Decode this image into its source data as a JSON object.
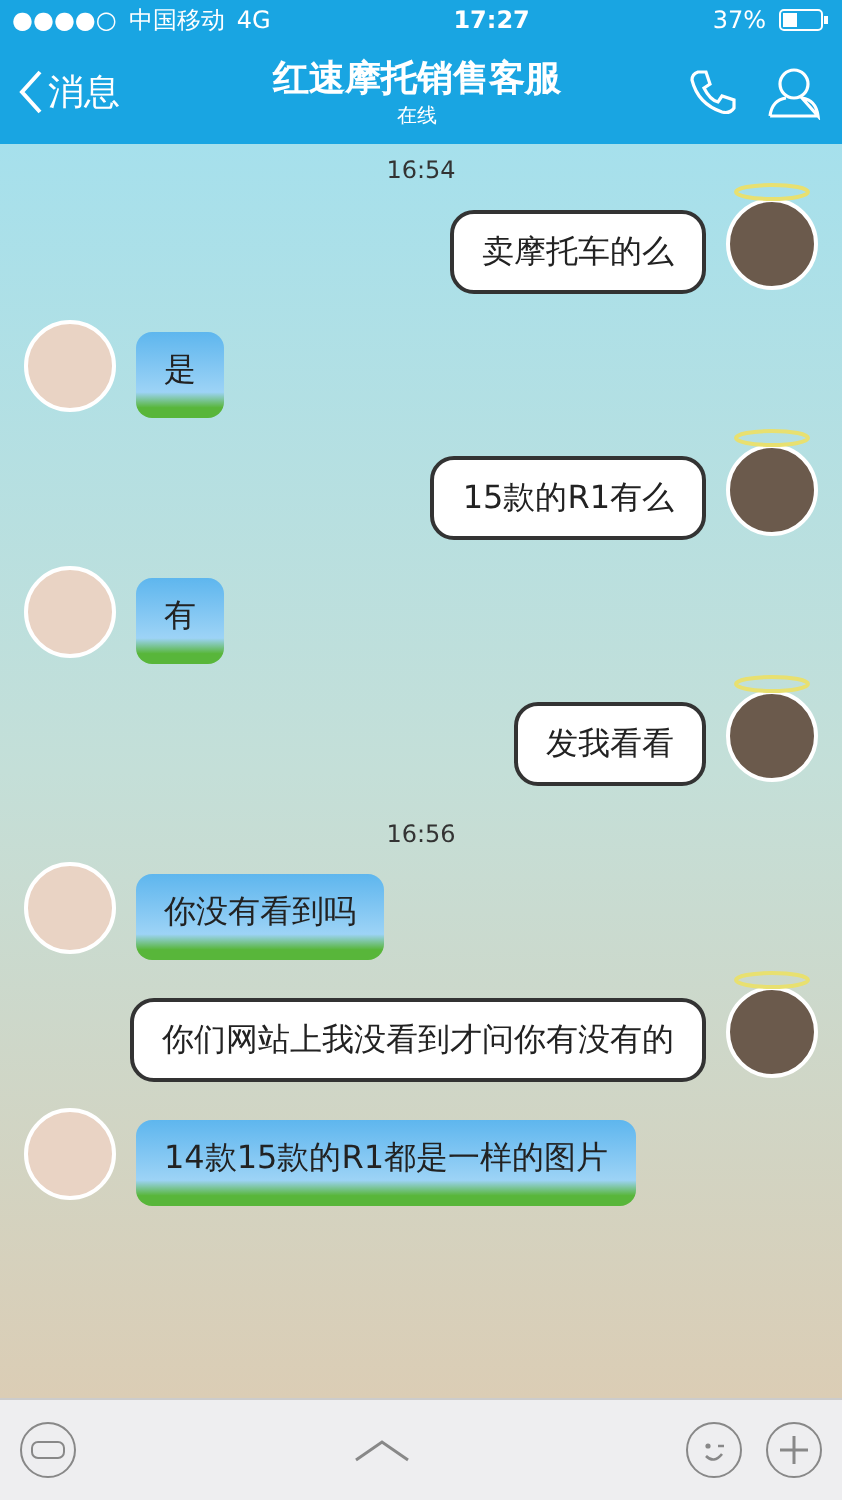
{
  "status_bar": {
    "signal": "●●●●○",
    "carrier": "中国移动",
    "network": "4G",
    "time": "17:27",
    "battery": "37%"
  },
  "nav": {
    "back": "消息",
    "title": "红速摩托销售客服",
    "subtitle": "在线"
  },
  "messages": [
    {
      "kind": "time",
      "text": "16:54"
    },
    {
      "kind": "message",
      "outgoing": true,
      "text": "卖摩托车的么"
    },
    {
      "kind": "message",
      "outgoing": false,
      "text": "是"
    },
    {
      "kind": "message",
      "outgoing": true,
      "text": "15款的R1有么"
    },
    {
      "kind": "message",
      "outgoing": false,
      "text": "有"
    },
    {
      "kind": "message",
      "outgoing": true,
      "text": "发我看看"
    },
    {
      "kind": "time",
      "text": "16:56"
    },
    {
      "kind": "message",
      "outgoing": false,
      "text": "你没有看到吗"
    },
    {
      "kind": "message",
      "outgoing": true,
      "text": "你们网站上我没看到才问你有没有的"
    },
    {
      "kind": "message",
      "outgoing": false,
      "text": "14款15款的R1都是一样的图片"
    }
  ]
}
